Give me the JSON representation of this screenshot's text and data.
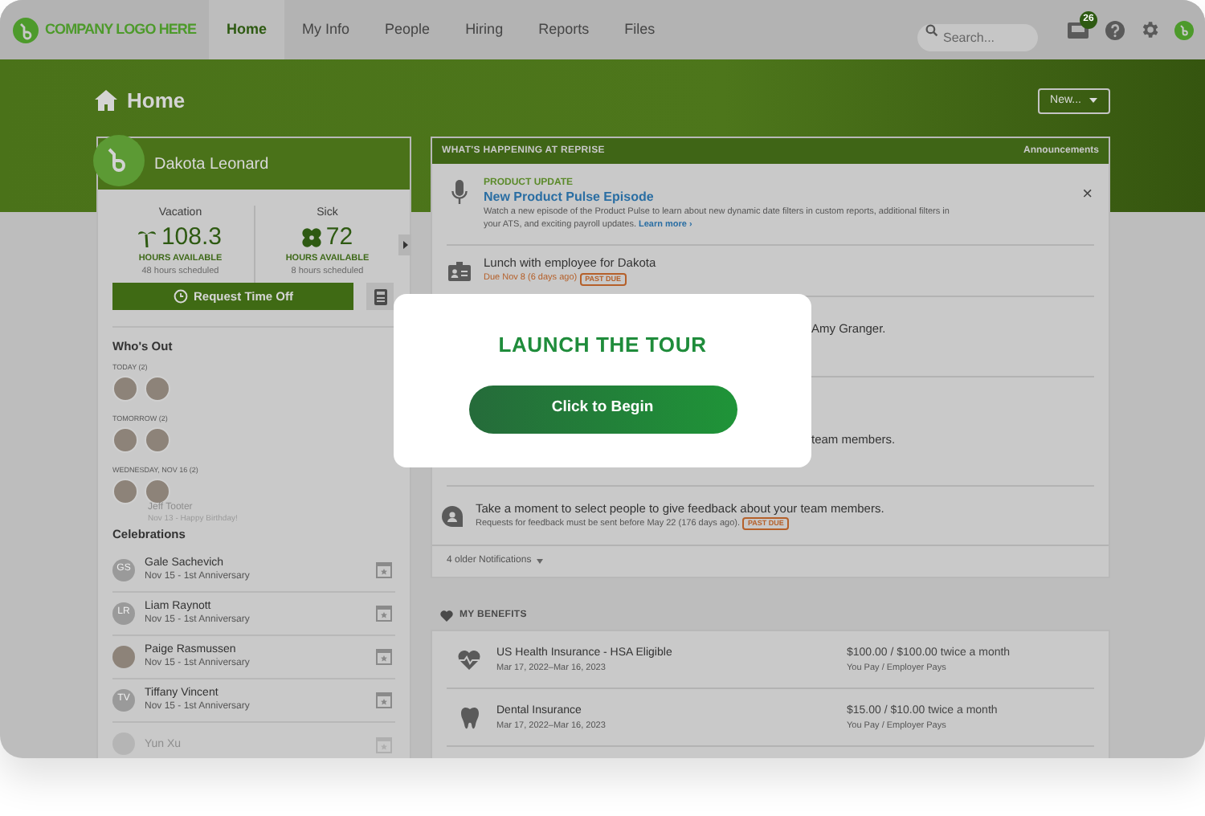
{
  "nav": {
    "logo": "COMPANY LOGO HERE",
    "tabs": [
      {
        "label": "Home",
        "selected": true
      },
      {
        "label": "My Info",
        "selected": false
      },
      {
        "label": "People",
        "selected": false
      },
      {
        "label": "Hiring",
        "selected": false
      },
      {
        "label": "Reports",
        "selected": false
      },
      {
        "label": "Files",
        "selected": false
      }
    ],
    "search": {
      "placeholder": "Search..."
    },
    "inbox_badge": "26"
  },
  "page": {
    "title": "Home",
    "new_button": "New..."
  },
  "profile": {
    "name": "Dakota Leonard",
    "balances": [
      {
        "kind": "vacation",
        "label": "Vacation",
        "value": "108.3",
        "caption": "HOURS AVAILABLE",
        "scheduled": "48 hours scheduled"
      },
      {
        "kind": "sick",
        "label": "Sick",
        "value": "72",
        "caption": "HOURS AVAILABLE",
        "scheduled": "8 hours scheduled"
      }
    ],
    "request_button": "Request Time Off",
    "whos_out": {
      "title": "Who's Out",
      "groups": [
        {
          "label": "TODAY (2)",
          "avatars": [
            {
              "kind": "photo"
            },
            {
              "kind": "photo"
            }
          ]
        },
        {
          "label": "TOMORROW (2)",
          "avatars": [
            {
              "kind": "photo"
            },
            {
              "kind": "photo"
            }
          ]
        },
        {
          "label": "WEDNESDAY, NOV 16 (2)",
          "avatars": [
            {
              "kind": "photo"
            },
            {
              "kind": "photo"
            }
          ]
        }
      ],
      "partial_row": {
        "name": "Jeff Tooter",
        "detail": "Nov 13 - Happy Birthday!"
      }
    },
    "celebrations": {
      "title": "Celebrations",
      "items": [
        {
          "avatar": {
            "kind": "initials",
            "text": "GS"
          },
          "name": "Gale Sachevich",
          "detail": "Nov 15 - 1st Anniversary",
          "faded": false
        },
        {
          "avatar": {
            "kind": "initials",
            "text": "LR"
          },
          "name": "Liam Raynott",
          "detail": "Nov 15 - 1st Anniversary",
          "faded": false
        },
        {
          "avatar": {
            "kind": "photo"
          },
          "name": "Paige Rasmussen",
          "detail": "Nov 15 - 1st Anniversary",
          "faded": false
        },
        {
          "avatar": {
            "kind": "initials",
            "text": "TV"
          },
          "name": "Tiffany Vincent",
          "detail": "Nov 15 - 1st Anniversary",
          "faded": false
        },
        {
          "avatar": {
            "kind": "initials"
          },
          "name": "Yun Xu",
          "faded": true
        }
      ]
    }
  },
  "happening": {
    "title": "WHAT'S HAPPENING AT REPRISE",
    "link": "Announcements",
    "items": [
      {
        "kind": "announcement",
        "category": "PRODUCT UPDATE",
        "title": "New Product Pulse Episode",
        "body": "Watch a new episode of the Product Pulse to learn about new dynamic date filters in custom reports, additional filters in your ATS, and exciting payroll updates.",
        "link": "Learn more ›",
        "close": "×"
      },
      {
        "kind": "task",
        "title": "Lunch with employee for Dakota",
        "due": "Due Nov 8 (6 days ago)",
        "badge": "PAST DUE"
      },
      {
        "kind": "covered",
        "title": "Amy Granger."
      },
      {
        "kind": "covered",
        "title": "team members."
      },
      {
        "kind": "feedback",
        "title": "Take a moment to select people to give feedback about your team members.",
        "due": "Requests for feedback must be sent before May 22 (176 days ago).",
        "badge": "PAST DUE"
      }
    ],
    "footer": "4 older Notifications"
  },
  "benefits": {
    "title": "MY BENEFITS",
    "items": [
      {
        "kind": "health",
        "name": "US Health Insurance - HSA Eligible",
        "dates": "Mar 17, 2022–Mar 16, 2023",
        "cost": "$100.00 / $100.00 twice a month",
        "payer": "You Pay / Employer Pays"
      },
      {
        "kind": "dental",
        "name": "Dental Insurance",
        "dates": "Mar 17, 2022–Mar 16, 2023",
        "cost": "$15.00 / $10.00 twice a month",
        "payer": "You Pay / Employer Pays"
      }
    ]
  },
  "tour": {
    "title": "LAUNCH THE TOUR",
    "button": "Click to Begin"
  }
}
